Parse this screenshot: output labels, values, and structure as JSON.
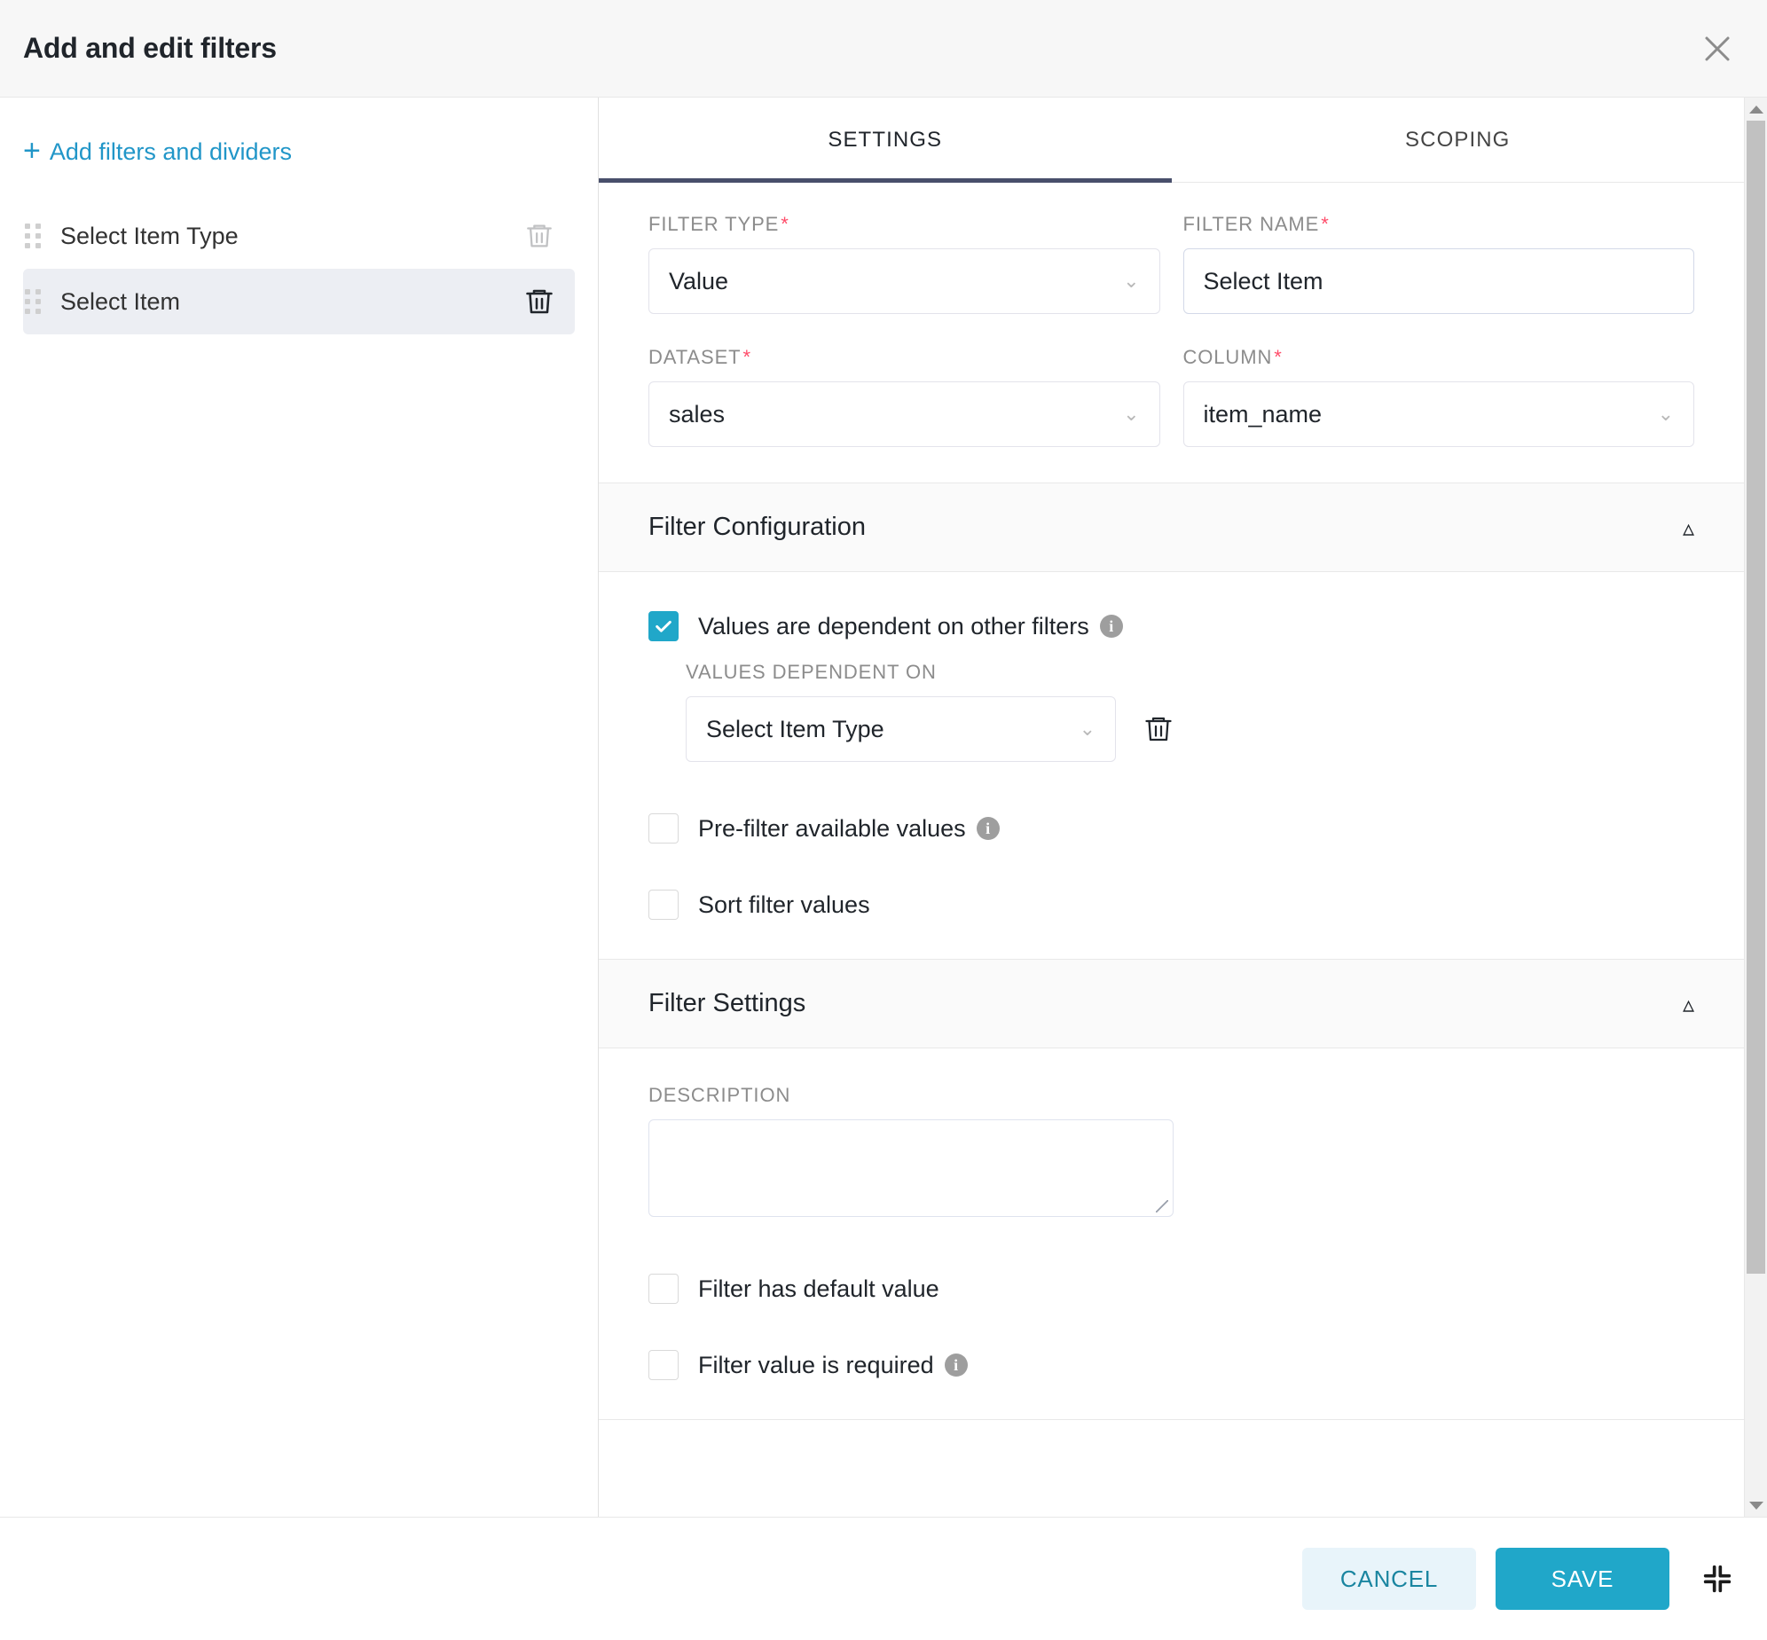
{
  "header": {
    "title": "Add and edit filters",
    "close_icon": "close-icon"
  },
  "sidebar": {
    "add_link": "Add filters and dividers",
    "add_icon": "plus-icon",
    "items": [
      {
        "label": "Select Item Type",
        "selected": false,
        "delete_icon": "trash-icon"
      },
      {
        "label": "Select Item",
        "selected": true,
        "delete_icon": "trash-icon"
      }
    ]
  },
  "tabs": [
    {
      "label": "SETTINGS",
      "active": true
    },
    {
      "label": "SCOPING",
      "active": false
    }
  ],
  "fields": {
    "filter_type": {
      "label": "FILTER TYPE",
      "required": "*",
      "value": "Value"
    },
    "filter_name": {
      "label": "FILTER NAME",
      "required": "*",
      "value": "Select Item"
    },
    "dataset": {
      "label": "DATASET",
      "required": "*",
      "value": "sales"
    },
    "column": {
      "label": "COLUMN",
      "required": "*",
      "value": "item_name"
    }
  },
  "filter_configuration": {
    "title": "Filter Configuration",
    "collapse_icon": "chevron-up-icon",
    "values_dependent": {
      "label": "Values are dependent on other filters",
      "checked": true,
      "info_icon": "info-icon"
    },
    "values_dependent_on": {
      "label": "VALUES DEPENDENT ON",
      "value": "Select Item Type",
      "delete_icon": "trash-icon"
    },
    "pre_filter": {
      "label": "Pre-filter available values",
      "checked": false,
      "info_icon": "info-icon"
    },
    "sort_values": {
      "label": "Sort filter values",
      "checked": false
    }
  },
  "filter_settings": {
    "title": "Filter Settings",
    "collapse_icon": "chevron-up-icon",
    "description": {
      "label": "DESCRIPTION",
      "value": "",
      "placeholder": ""
    },
    "has_default": {
      "label": "Filter has default value",
      "checked": false
    },
    "is_required": {
      "label": "Filter value is required",
      "checked": false,
      "info_icon": "info-icon"
    }
  },
  "footer": {
    "cancel_label": "CANCEL",
    "save_label": "SAVE",
    "expand_icon": "collapse-arrows-icon"
  },
  "colors": {
    "accent": "#20a7c9",
    "link": "#2196c8",
    "tab_underline": "#484f6b",
    "required": "#ff4d6a",
    "selected_row": "#eceef3"
  },
  "scrollbar": {
    "up_icon": "scroll-up-arrow",
    "down_icon": "scroll-down-arrow"
  }
}
